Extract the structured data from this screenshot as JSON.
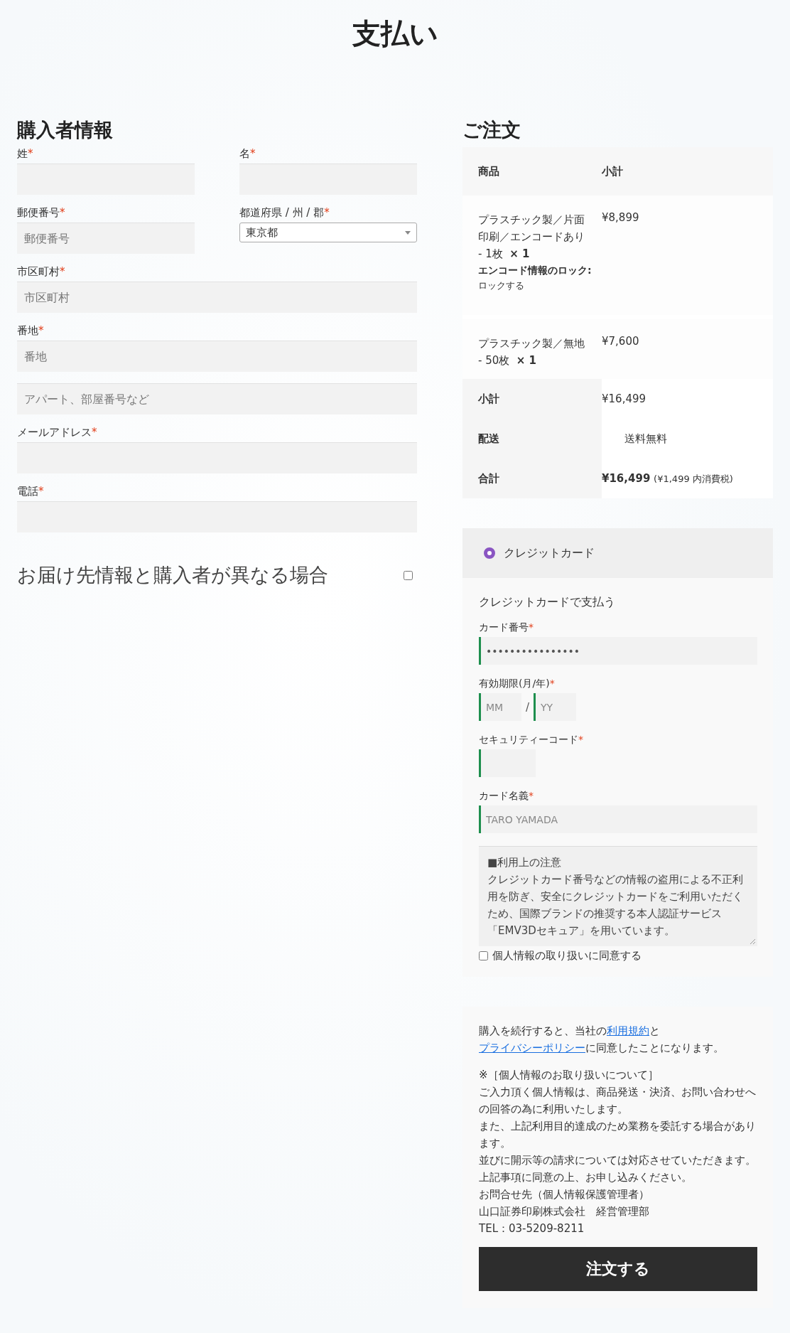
{
  "title": "支払い",
  "billing": {
    "heading": "購入者情報",
    "rows": [
      [
        {
          "kind": "text",
          "label": "姓",
          "required_mark": "*"
        },
        {
          "kind": "text",
          "label": "名",
          "required_mark": "*"
        }
      ],
      [
        {
          "kind": "text",
          "label": "郵便番号",
          "required_mark": "*",
          "placeholder": "郵便番号"
        },
        {
          "kind": "select",
          "label": "都道府県 / 州 / 郡",
          "required_mark": "*",
          "value": "東京都"
        }
      ],
      [
        {
          "kind": "text",
          "label": "市区町村",
          "required_mark": "*",
          "placeholder": "市区町村"
        }
      ],
      [
        {
          "kind": "text",
          "label": "番地",
          "required_mark": "*",
          "placeholder": "番地"
        }
      ],
      [
        {
          "kind": "text",
          "placeholder": "アパート、部屋番号など"
        }
      ],
      [
        {
          "kind": "text",
          "label": "メールアドレス",
          "required_mark": "*"
        }
      ],
      [
        {
          "kind": "text",
          "label": "電話",
          "required_mark": "*"
        }
      ]
    ],
    "ship_to_different": {
      "label": "お届け先情報と購入者が異なる場合",
      "checked": false
    }
  },
  "order": {
    "heading": "ご注文",
    "columns": [
      "商品",
      "小計"
    ],
    "items": [
      {
        "name": "プラスチック製／片面印刷／エンコードあり - 1枚",
        "qty": "× 1",
        "meta_label": "エンコード情報のロック:",
        "meta_value": "ロックする",
        "subtotal": "¥8,899"
      },
      {
        "name": "プラスチック製／無地 - 50枚",
        "qty": "× 1",
        "subtotal": "¥7,600"
      }
    ],
    "totals": [
      {
        "kind": "plain",
        "label": "小計",
        "value": "¥16,499"
      },
      {
        "kind": "shipping",
        "label": "配送",
        "value": "送料無料"
      },
      {
        "kind": "grand",
        "label": "合計",
        "value": "¥16,499",
        "note": "(¥1,499 内消費税)"
      }
    ]
  },
  "payment": {
    "methods": [
      {
        "label": "クレジットカード",
        "selected": true
      }
    ],
    "description": "クレジットカードで支払う",
    "fields": [
      {
        "kind": "text",
        "label": "カード番号",
        "required_mark": "*",
        "value": "••••••••••••••••"
      },
      {
        "kind": "expiry",
        "label": "有効期限(月/年)",
        "required_mark": "*",
        "parts": [
          {
            "placeholder": "MM"
          },
          {
            "placeholder": "YY"
          }
        ],
        "separator": "/"
      },
      {
        "kind": "code",
        "label": "セキュリティーコード",
        "required_mark": "*"
      },
      {
        "kind": "text",
        "label": "カード名義",
        "required_mark": "*",
        "placeholder": "TARO YAMADA"
      }
    ],
    "notice_lines": [
      "■利用上の注意",
      "クレジットカード番号などの情報の盗用による不正利用を防ぎ、安全にクレジットカードをご利用いただくため、国際ブランドの推奨する本人認証サービス「EMV3Dセキュア」を用いています。"
    ],
    "consent": {
      "label": "個人情報の取り扱いに同意する",
      "checked": false
    }
  },
  "terms": {
    "parts": [
      {
        "kind": "text",
        "text": "購入を続行すると、当社の"
      },
      {
        "kind": "link",
        "text": "利用規約"
      },
      {
        "kind": "text",
        "text": "と"
      },
      {
        "kind": "link",
        "text": "プライバシーポリシー"
      },
      {
        "kind": "text",
        "text": "に同意したことになります。"
      }
    ],
    "privacy_lines": [
      "※［個人情報のお取り扱いについて］",
      "ご入力頂く個人情報は、商品発送・決済、お問い合わせへの回答の為に利用いたします。",
      "また、上記利用目的達成のため業務を委託する場合があります。",
      "並びに開示等の請求については対応させていただきます。",
      "上記事項に同意の上、お申し込みください。",
      "お問合せ先（個人情報保護管理者）",
      "山口証券印刷株式会社　経営管理部",
      "TEL：03-5209-8211"
    ],
    "button": "注文する"
  }
}
